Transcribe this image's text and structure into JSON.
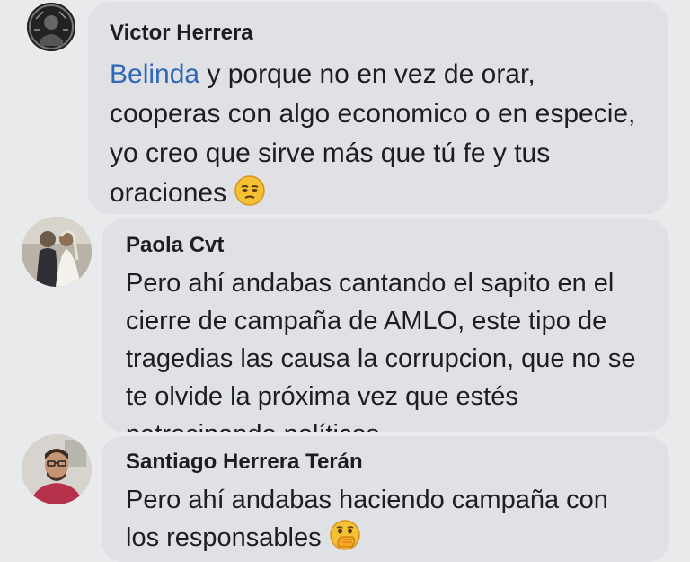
{
  "comments": [
    {
      "author": "Victor Herrera",
      "mention": "Belinda",
      "text": " y porque no en vez de orar, cooperas con algo economico o en especie, yo creo que sirve más que tú fe y tus oraciones ",
      "emoji": "unamused-face-icon",
      "avatar": "avatar-dark-figure"
    },
    {
      "author": "Paola Cvt",
      "text": "Pero ahí andabas cantando el sapito en el cierre de campaña de AMLO, este tipo de tragedias las causa la corrupcion, que no se te olvide la próxima vez que estés patrocinando políticos.",
      "avatar": "avatar-wedding-couple"
    },
    {
      "author": "Santiago Herrera Terán",
      "text": "Pero ahí andabas haciendo campaña con los responsables ",
      "emoji": "face-with-hand-over-mouth-icon",
      "avatar": "avatar-man-glasses"
    }
  ],
  "colors": {
    "background": "#e9eaec",
    "bubble": "#dfe1e5",
    "text": "#1c1e21",
    "mention": "#2e67b8"
  }
}
